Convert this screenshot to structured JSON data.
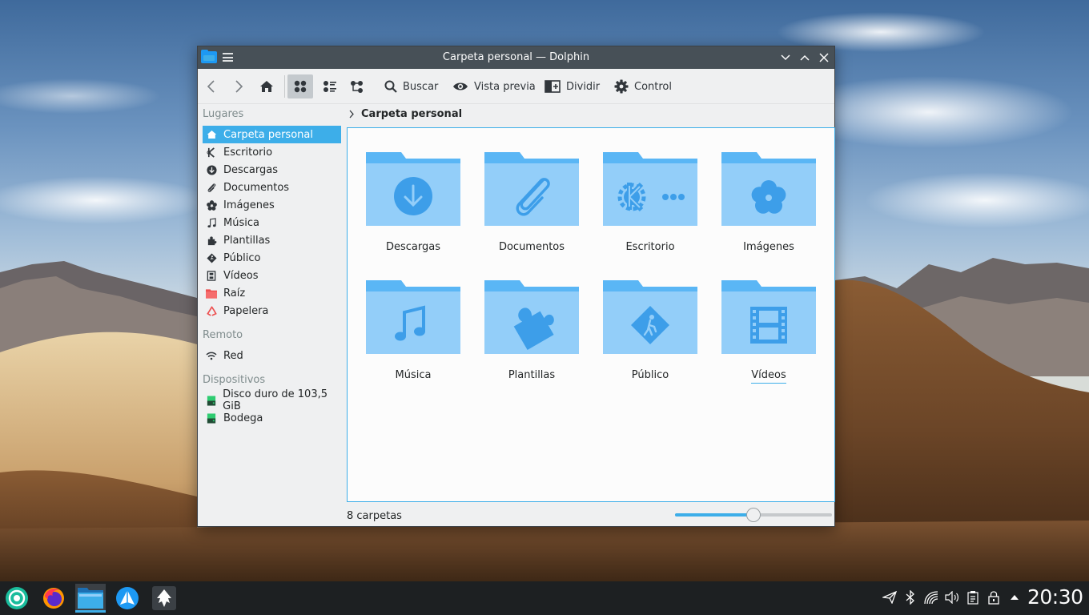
{
  "window": {
    "title": "Carpeta personal — Dolphin",
    "controls": [
      "minimize",
      "maximize",
      "close"
    ]
  },
  "toolbar": {
    "back_icon": "chevron-left-icon",
    "forward_icon": "chevron-right-icon",
    "home_icon": "home-icon",
    "view_modes": [
      "icons",
      "compact",
      "details"
    ],
    "active_view": "icons",
    "search_label": "Buscar",
    "preview_label": "Vista previa",
    "split_label": "Dividir",
    "control_label": "Control"
  },
  "sidebar": {
    "places_title": "Lugares",
    "places": [
      {
        "label": "Carpeta personal",
        "icon": "home-icon",
        "selected": true
      },
      {
        "label": "Escritorio",
        "icon": "desktop-icon"
      },
      {
        "label": "Descargas",
        "icon": "download-icon"
      },
      {
        "label": "Documentos",
        "icon": "paperclip-icon"
      },
      {
        "label": "Imágenes",
        "icon": "flower-icon"
      },
      {
        "label": "Música",
        "icon": "music-note-icon"
      },
      {
        "label": "Plantillas",
        "icon": "puzzle-icon"
      },
      {
        "label": "Público",
        "icon": "public-icon"
      },
      {
        "label": "Vídeos",
        "icon": "film-icon"
      },
      {
        "label": "Raíz",
        "icon": "red-folder-icon"
      },
      {
        "label": "Papelera",
        "icon": "trash-icon"
      }
    ],
    "remote_title": "Remoto",
    "remote": [
      {
        "label": "Red",
        "icon": "network-icon"
      }
    ],
    "devices_title": "Dispositivos",
    "devices": [
      {
        "label": "Disco duro de 103,5 GiB",
        "icon": "drive-icon"
      },
      {
        "label": "Bodega",
        "icon": "drive-icon"
      }
    ]
  },
  "breadcrumb": {
    "current": "Carpeta personal"
  },
  "folders": [
    {
      "name": "Descargas",
      "icon": "download-folder-icon"
    },
    {
      "name": "Documentos",
      "icon": "paperclip-folder-icon"
    },
    {
      "name": "Escritorio",
      "icon": "kde-desktop-folder-icon"
    },
    {
      "name": "Imágenes",
      "icon": "flower-folder-icon"
    },
    {
      "name": "Música",
      "icon": "music-folder-icon"
    },
    {
      "name": "Plantillas",
      "icon": "puzzle-folder-icon"
    },
    {
      "name": "Público",
      "icon": "public-folder-icon"
    },
    {
      "name": "Vídeos",
      "icon": "film-folder-icon"
    }
  ],
  "status": {
    "count_text": "8 carpetas",
    "zoom_level": 0.5
  },
  "taskbar": {
    "apps": [
      "launcher-icon",
      "firefox-icon",
      "dolphin-icon",
      "discover-icon",
      "inkscape-icon"
    ],
    "active_app": "dolphin-icon",
    "tray": [
      "send-icon",
      "bluetooth-icon",
      "wifi-icon",
      "volume-icon",
      "clipboard-icon",
      "lock-icon",
      "expand-tray-icon"
    ],
    "clock": "20:30"
  },
  "colors": {
    "accent": "#3daee9",
    "titlebar": "#475057",
    "folder_light": "#93cef9",
    "folder_tab": "#5ab6f5",
    "folder_emblem": "#3d9ee9",
    "taskbar": "#1d2022"
  }
}
